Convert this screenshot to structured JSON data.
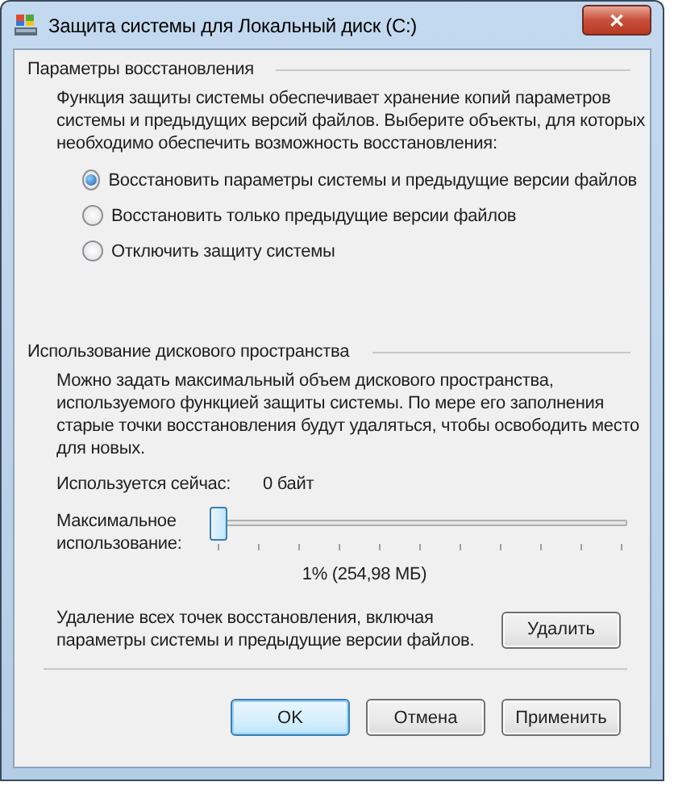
{
  "window": {
    "title": "Защита системы для Локальный диск (C:)",
    "close": "✕"
  },
  "restore_settings": {
    "heading": "Параметры восстановления",
    "description": "Функция защиты системы обеспечивает хранение копий параметров системы и предыдущих версий файлов. Выберите объекты, для которых необходимо обеспечить возможность восстановления:",
    "options": [
      {
        "label": "Восстановить параметры системы и предыдущие версии файлов",
        "selected": true
      },
      {
        "label": "Восстановить только предыдущие версии файлов",
        "selected": false
      },
      {
        "label": "Отключить защиту системы",
        "selected": false
      }
    ]
  },
  "disk_usage": {
    "heading": "Использование дискового пространства",
    "description": "Можно задать максимальный объем дискового пространства, используемого функцией защиты системы. По мере его заполнения старые точки восстановления будут удаляться, чтобы освободить место для новых.",
    "current_label": "Используется сейчас:",
    "current_value": "0 байт",
    "max_label": "Максимальное использование:",
    "slider": {
      "level": 0.0
    },
    "slider_reading": "1% (254,98 МБ)",
    "delete_text": "Удаление всех точек восстановления, включая параметры системы и предыдущие версии файлов.",
    "delete_button": "Удалить"
  },
  "buttons": [
    {
      "label": "OK",
      "default": true
    },
    {
      "label": "Отмена",
      "default": false
    },
    {
      "label": "Применить",
      "default": false
    }
  ]
}
